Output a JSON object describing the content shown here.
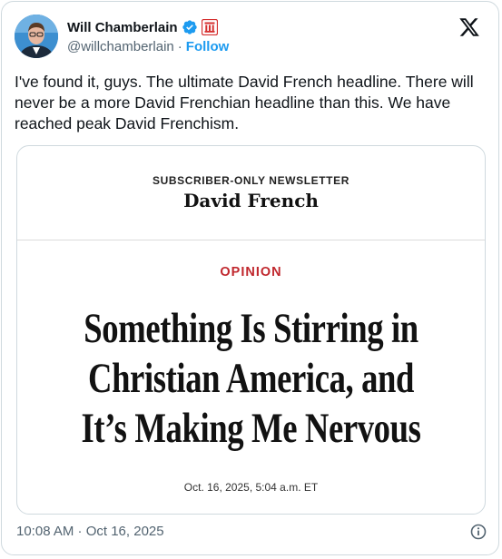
{
  "author": {
    "display_name": "Will Chamberlain",
    "handle": "@willchamberlain",
    "separator": "·",
    "follow_label": "Follow"
  },
  "tweet": {
    "text": "I've found it, guys. The ultimate David French headline. There will never be a more David Frenchian headline than this. We have reached peak David Frenchism."
  },
  "card": {
    "newsletter_label": "SUBSCRIBER-ONLY NEWSLETTER",
    "newsletter_name": "David French",
    "section": "OPINION",
    "headline_lines": [
      "Something Is Stirring in",
      "Christian America, and",
      "It’s Making Me Nervous"
    ],
    "dateline": "Oct. 16, 2025, 5:04 a.m. ET"
  },
  "timestamp": "10:08 AM · Oct 16, 2025",
  "colors": {
    "follow": "#1d9bf0",
    "verified": "#1d9bf0",
    "affiliation": "#d52f2f",
    "opinion": "#c0272d",
    "secondary_text": "#536471"
  },
  "icons": {
    "verified": "verified-badge-icon",
    "affiliation": "affiliation-badge-icon",
    "logo": "x-logo-icon",
    "info": "info-icon"
  }
}
